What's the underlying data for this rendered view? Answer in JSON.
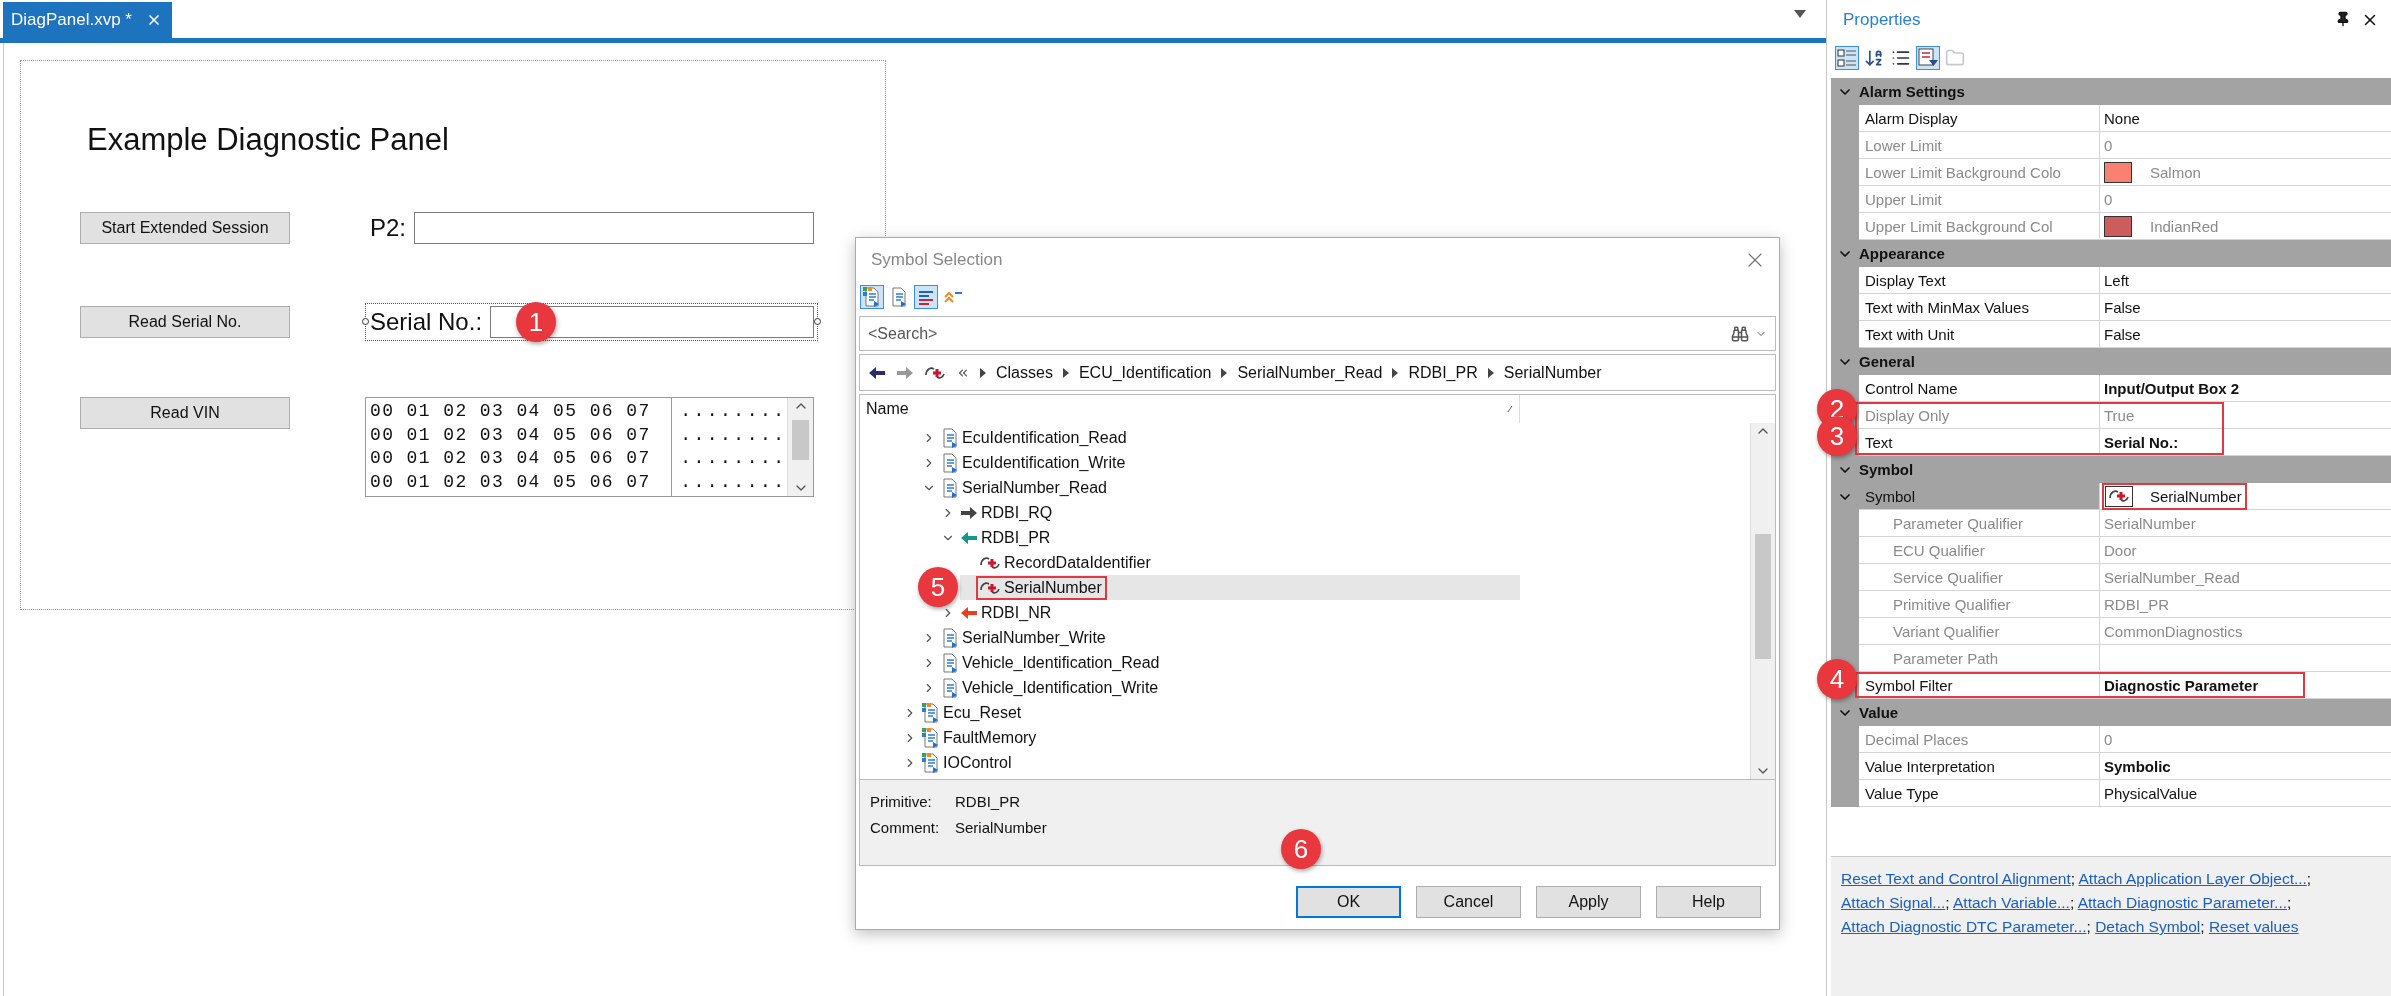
{
  "document_tab": {
    "title": "DiagPanel.xvp *",
    "selected": true
  },
  "panel": {
    "title": "Example Diagnostic Panel",
    "rows": [
      {
        "kind": "field",
        "button": "Start Extended Session",
        "label": "P2:"
      },
      {
        "kind": "field",
        "button": "Read Serial No.",
        "label": "Serial No.:",
        "selected": true,
        "callout": "1"
      },
      {
        "kind": "hex",
        "button": "Read VIN",
        "hex_rows": [
          {
            "hex": "00 01 02 03 04 05 06 07",
            "ascii": "........"
          },
          {
            "hex": "00 01 02 03 04 05 06 07",
            "ascii": "........"
          },
          {
            "hex": "00 01 02 03 04 05 06 07",
            "ascii": "........"
          },
          {
            "hex": "00 01 02 03 04 05 06 07",
            "ascii": "........"
          }
        ]
      }
    ]
  },
  "dialog": {
    "title": "Symbol Selection",
    "toolbar": [
      {
        "kind": "class-view",
        "pressed": true
      },
      {
        "kind": "service-view",
        "pressed": false
      },
      {
        "kind": "text-compare",
        "pressed": true
      },
      {
        "kind": "collapse",
        "pressed": false
      }
    ],
    "search": {
      "placeholder": "<Search>"
    },
    "breadcrumb": [
      "Classes",
      "ECU_Identification",
      "SerialNumber_Read",
      "RDBI_PR",
      "SerialNumber"
    ],
    "tree": {
      "column": "Name",
      "items": [
        {
          "kind": "hidden-parent",
          "children": [
            {
              "kind": "service",
              "label": "EcuIdentification_Read",
              "expanded": false,
              "selected": false
            },
            {
              "kind": "service",
              "label": "EcuIdentification_Write",
              "expanded": false,
              "selected": false
            },
            {
              "kind": "service",
              "label": "SerialNumber_Read",
              "expanded": true,
              "selected": false,
              "children": [
                {
                  "kind": "request",
                  "label": "RDBI_RQ",
                  "expanded": false,
                  "selected": false
                },
                {
                  "kind": "response",
                  "label": "RDBI_PR",
                  "expanded": true,
                  "selected": false,
                  "children": [
                    {
                      "kind": "parameter",
                      "label": "RecordDataIdentifier",
                      "selected": false
                    },
                    {
                      "kind": "parameter",
                      "label": "SerialNumber",
                      "selected": true,
                      "highlighted": true,
                      "callout": "5"
                    }
                  ]
                },
                {
                  "kind": "negative",
                  "label": "RDBI_NR",
                  "expanded": false,
                  "selected": false
                }
              ]
            },
            {
              "kind": "service",
              "label": "SerialNumber_Write",
              "expanded": false,
              "selected": false
            },
            {
              "kind": "service",
              "label": "Vehicle_Identification_Read",
              "expanded": false,
              "selected": false
            },
            {
              "kind": "service",
              "label": "Vehicle_Identification_Write",
              "expanded": false,
              "selected": false
            }
          ]
        },
        {
          "kind": "class",
          "label": "Ecu_Reset",
          "expanded": false,
          "selected": false
        },
        {
          "kind": "class",
          "label": "FaultMemory",
          "expanded": false,
          "selected": false
        },
        {
          "kind": "class",
          "label": "IOControl",
          "expanded": false,
          "selected": false
        }
      ]
    },
    "info": [
      {
        "label": "Primitive:",
        "value": "RDBI_PR"
      },
      {
        "label": "Comment:",
        "value": "SerialNumber"
      }
    ],
    "buttons": [
      {
        "label": "OK",
        "default": true,
        "callout": "6"
      },
      {
        "label": "Cancel",
        "default": false
      },
      {
        "label": "Apply",
        "default": false
      },
      {
        "label": "Help",
        "default": false
      }
    ]
  },
  "properties": {
    "title": "Properties",
    "toolbar": [
      {
        "kind": "categorized",
        "pressed": true,
        "disabled": false
      },
      {
        "kind": "alphabetical",
        "pressed": false,
        "disabled": false
      },
      {
        "kind": "list",
        "pressed": false,
        "disabled": false
      },
      {
        "kind": "filter",
        "pressed": true,
        "disabled": false
      },
      {
        "kind": "pages",
        "pressed": false,
        "disabled": true
      }
    ],
    "categories": [
      {
        "name": "Alarm Settings",
        "expanded": true,
        "rows": [
          {
            "name": "Alarm Display",
            "value": "None",
            "disabled": false
          },
          {
            "name": "Lower Limit",
            "value": "0",
            "disabled": true
          },
          {
            "name": "Lower Limit Background Colo",
            "value": "Salmon",
            "color": "#fa8072",
            "disabled": true
          },
          {
            "name": "Upper Limit",
            "value": "0",
            "disabled": true
          },
          {
            "name": "Upper Limit Background Col",
            "value": "IndianRed",
            "color": "#cd5c5c",
            "disabled": true
          }
        ]
      },
      {
        "name": "Appearance",
        "expanded": true,
        "rows": [
          {
            "name": "Display Text",
            "value": "Left",
            "disabled": false
          },
          {
            "name": "Text with MinMax Values",
            "value": "False",
            "disabled": false
          },
          {
            "name": "Text with Unit",
            "value": "False",
            "disabled": false
          }
        ]
      },
      {
        "name": "General",
        "expanded": true,
        "rows": [
          {
            "name": "Control Name",
            "value": "Input/Output Box 2",
            "disabled": false,
            "modified": true
          },
          {
            "name": "Display Only",
            "value": "True",
            "disabled": true,
            "highlighted": true,
            "callout": "2"
          },
          {
            "name": "Text",
            "value": "Serial No.:",
            "disabled": false,
            "modified": true,
            "highlighted": true,
            "callout": "3"
          }
        ]
      },
      {
        "name": "Symbol",
        "expanded": true,
        "rows": [
          {
            "name": "Symbol",
            "value": "SerialNumber",
            "kind": "symbol",
            "expanded": true,
            "disabled": false,
            "highlighted": true,
            "children": [
              {
                "name": "Parameter Qualifier",
                "value": "SerialNumber",
                "disabled": true
              },
              {
                "name": "ECU Qualifier",
                "value": "Door",
                "disabled": true
              },
              {
                "name": "Service Qualifier",
                "value": "SerialNumber_Read",
                "disabled": true
              },
              {
                "name": "Primitive Qualifier",
                "value": "RDBI_PR",
                "disabled": true
              },
              {
                "name": "Variant Qualifier",
                "value": "CommonDiagnostics",
                "disabled": true
              },
              {
                "name": "Parameter Path",
                "disabled": true
              }
            ]
          },
          {
            "name": "Symbol Filter",
            "value": "Diagnostic Parameter",
            "disabled": false,
            "modified": true,
            "highlighted": true,
            "callout": "4"
          }
        ]
      },
      {
        "name": "Value",
        "expanded": true,
        "rows": [
          {
            "name": "Decimal Places",
            "value": "0",
            "disabled": true
          },
          {
            "name": "Value Interpretation",
            "value": "Symbolic",
            "disabled": false,
            "modified": true
          },
          {
            "name": "Value Type",
            "value": "PhysicalValue",
            "disabled": false
          }
        ]
      }
    ],
    "commands": {
      "separator": ";",
      "links": [
        "Reset Text and Control Alignment",
        "Attach Application Layer Object...",
        "Attach Signal...",
        "Attach Variable...",
        "Attach Diagnostic Parameter...",
        "Attach Diagnostic DTC Parameter...",
        "Detach Symbol",
        "Reset values"
      ]
    }
  }
}
